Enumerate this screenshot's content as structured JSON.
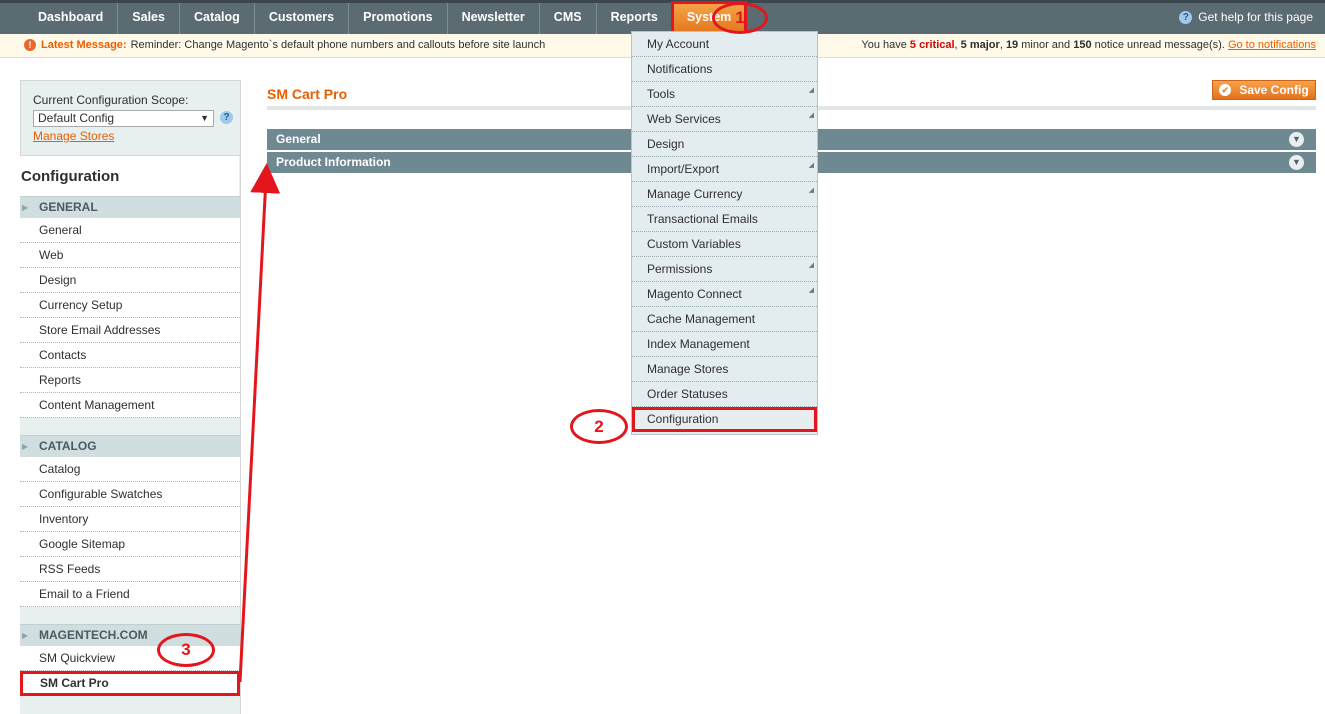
{
  "topnav": {
    "items": [
      "Dashboard",
      "Sales",
      "Catalog",
      "Customers",
      "Promotions",
      "Newsletter",
      "CMS",
      "Reports",
      "System"
    ],
    "active": "System",
    "help": "Get help for this page"
  },
  "message": {
    "label": "Latest Message:",
    "text": "Reminder: Change Magento`s default phone numbers and callouts before site launch",
    "summary_prefix": "You have ",
    "critical": "5 critical",
    "sep1": ", ",
    "major": "5 major",
    "sep2": ", ",
    "minor": "19",
    "minor_suffix": " minor and ",
    "notice": "150",
    "notice_suffix": " notice unread message(s). ",
    "link": "Go to notifications"
  },
  "scope": {
    "label": "Current Configuration Scope:",
    "value": "Default Config",
    "manage_link": "Manage Stores"
  },
  "sidebar": {
    "title": "Configuration",
    "sections": [
      {
        "name": "GENERAL",
        "items": [
          "General",
          "Web",
          "Design",
          "Currency Setup",
          "Store Email Addresses",
          "Contacts",
          "Reports",
          "Content Management"
        ]
      },
      {
        "name": "CATALOG",
        "items": [
          "Catalog",
          "Configurable Swatches",
          "Inventory",
          "Google Sitemap",
          "RSS Feeds",
          "Email to a Friend"
        ]
      },
      {
        "name": "MAGENTECH.COM",
        "items": [
          "SM Quickview",
          "SM Cart Pro"
        ]
      }
    ],
    "current_item": "SM Cart Pro"
  },
  "main": {
    "title": "SM Cart Pro",
    "save_label": "Save Config",
    "fieldsets": [
      "General",
      "Product Information"
    ]
  },
  "system_menu": {
    "items": [
      {
        "label": "My Account",
        "has_sub": false
      },
      {
        "label": "Notifications",
        "has_sub": false
      },
      {
        "label": "Tools",
        "has_sub": true
      },
      {
        "label": "Web Services",
        "has_sub": true
      },
      {
        "label": "Design",
        "has_sub": false
      },
      {
        "label": "Import/Export",
        "has_sub": true
      },
      {
        "label": "Manage Currency",
        "has_sub": true
      },
      {
        "label": "Transactional Emails",
        "has_sub": false
      },
      {
        "label": "Custom Variables",
        "has_sub": false
      },
      {
        "label": "Permissions",
        "has_sub": true
      },
      {
        "label": "Magento Connect",
        "has_sub": true
      },
      {
        "label": "Cache Management",
        "has_sub": false
      },
      {
        "label": "Index Management",
        "has_sub": false
      },
      {
        "label": "Manage Stores",
        "has_sub": false
      },
      {
        "label": "Order Statuses",
        "has_sub": false
      },
      {
        "label": "Configuration",
        "has_sub": false
      }
    ],
    "current_item": "Configuration"
  },
  "annotations": [
    "1",
    "2",
    "3"
  ],
  "colors": {
    "accent": "#eb5e00",
    "highlight": "#e3161d",
    "nav_bg": "#5a6b72",
    "fieldset_bg": "#6f8992"
  }
}
